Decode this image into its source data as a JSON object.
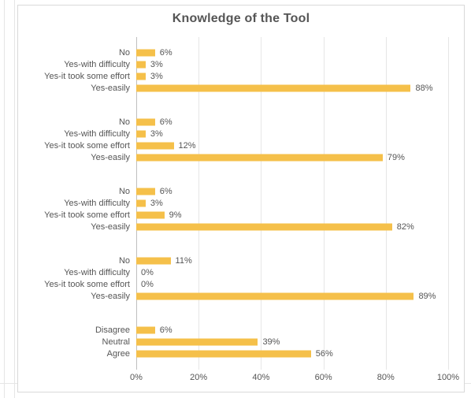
{
  "chart_data": {
    "type": "bar",
    "orientation": "horizontal",
    "title": "Knowledge of the Tool",
    "xlabel": "",
    "ylabel": "",
    "xlim": [
      0,
      100
    ],
    "xticks": [
      0,
      20,
      40,
      60,
      80,
      100
    ],
    "xtick_labels": [
      "0%",
      "20%",
      "40%",
      "60%",
      "80%",
      "100%"
    ],
    "bar_color": "#f5c04a",
    "groups": [
      {
        "items": [
          {
            "label": "No",
            "value": 6,
            "display": "6%"
          },
          {
            "label": "Yes-with difficulty",
            "value": 3,
            "display": "3%"
          },
          {
            "label": "Yes-it took some effort",
            "value": 3,
            "display": "3%"
          },
          {
            "label": "Yes-easily",
            "value": 88,
            "display": "88%"
          }
        ]
      },
      {
        "items": [
          {
            "label": "No",
            "value": 6,
            "display": "6%"
          },
          {
            "label": "Yes-with difficulty",
            "value": 3,
            "display": "3%"
          },
          {
            "label": "Yes-it took some effort",
            "value": 12,
            "display": "12%"
          },
          {
            "label": "Yes-easily",
            "value": 79,
            "display": "79%"
          }
        ]
      },
      {
        "items": [
          {
            "label": "No",
            "value": 6,
            "display": "6%"
          },
          {
            "label": "Yes-with difficulty",
            "value": 3,
            "display": "3%"
          },
          {
            "label": "Yes-it took some effort",
            "value": 9,
            "display": "9%"
          },
          {
            "label": "Yes-easily",
            "value": 82,
            "display": "82%"
          }
        ]
      },
      {
        "items": [
          {
            "label": "No",
            "value": 11,
            "display": "11%"
          },
          {
            "label": "Yes-with difficulty",
            "value": 0,
            "display": "0%"
          },
          {
            "label": "Yes-it took some effort",
            "value": 0,
            "display": "0%"
          },
          {
            "label": "Yes-easily",
            "value": 89,
            "display": "89%"
          }
        ]
      },
      {
        "items": [
          {
            "label": "Disagree",
            "value": 6,
            "display": "6%"
          },
          {
            "label": "Neutral",
            "value": 39,
            "display": "39%"
          },
          {
            "label": "Agree",
            "value": 56,
            "display": "56%"
          }
        ]
      }
    ]
  }
}
